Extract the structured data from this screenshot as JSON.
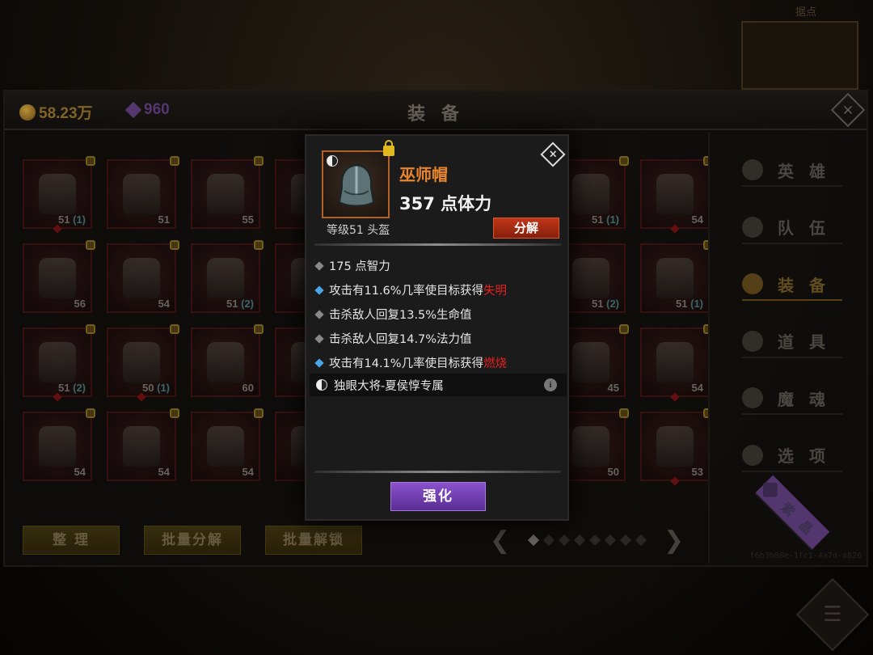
{
  "background": {
    "top_label": "据点",
    "menu_icon": "list-icon"
  },
  "header": {
    "gold": "58.23万",
    "gems": "960",
    "title": "装 备",
    "gold_icon": "coin-icon",
    "gem_icon": "gem-icon"
  },
  "grid": {
    "slots": [
      {
        "lvl": "51",
        "bonus": "(1)",
        "lock": true,
        "pip": true
      },
      {
        "lvl": "51",
        "bonus": "",
        "lock": true,
        "pip": false
      },
      {
        "lvl": "55",
        "bonus": "",
        "lock": true,
        "pip": false
      },
      {
        "lvl": "",
        "bonus": "",
        "lock": true,
        "pip": false
      },
      {
        "lvl": "51",
        "bonus": "(1)",
        "lock": true,
        "pip": false
      },
      {
        "lvl": "54",
        "bonus": "",
        "lock": true,
        "pip": true
      },
      {
        "lvl": "56",
        "bonus": "",
        "lock": true,
        "pip": false
      },
      {
        "lvl": "54",
        "bonus": "",
        "lock": true,
        "pip": false
      },
      {
        "lvl": "51",
        "bonus": "(2)",
        "lock": true,
        "pip": false
      },
      {
        "lvl": "",
        "bonus": "",
        "lock": true,
        "pip": false
      },
      {
        "lvl": "51",
        "bonus": "(2)",
        "lock": false,
        "pip": false
      },
      {
        "lvl": "51",
        "bonus": "(1)",
        "lock": true,
        "pip": false
      },
      {
        "lvl": "51",
        "bonus": "(2)",
        "lock": true,
        "pip": true
      },
      {
        "lvl": "50",
        "bonus": "(1)",
        "lock": true,
        "pip": true
      },
      {
        "lvl": "60",
        "bonus": "",
        "lock": true,
        "pip": false
      },
      {
        "lvl": "",
        "bonus": "",
        "lock": true,
        "pip": false
      },
      {
        "lvl": "45",
        "bonus": "",
        "lock": true,
        "pip": false
      },
      {
        "lvl": "54",
        "bonus": "",
        "lock": true,
        "pip": true
      },
      {
        "lvl": "54",
        "bonus": "",
        "lock": true,
        "pip": false
      },
      {
        "lvl": "54",
        "bonus": "",
        "lock": true,
        "pip": false
      },
      {
        "lvl": "54",
        "bonus": "",
        "lock": true,
        "pip": false
      },
      {
        "lvl": "",
        "bonus": "",
        "lock": true,
        "pip": false
      },
      {
        "lvl": "50",
        "bonus": "",
        "lock": true,
        "pip": false
      },
      {
        "lvl": "53",
        "bonus": "",
        "lock": true,
        "pip": true
      }
    ]
  },
  "sidenav": {
    "items": [
      {
        "label": "英 雄",
        "icon": "hero-icon"
      },
      {
        "label": "队 伍",
        "icon": "flag-icon"
      },
      {
        "label": "装 备",
        "icon": "helmet-icon"
      },
      {
        "label": "道 具",
        "icon": "bag-icon"
      },
      {
        "label": "魔 魂",
        "icon": "flame-icon"
      },
      {
        "label": "选 项",
        "icon": "gear-icon"
      },
      {
        "label": "紫 晶",
        "icon": "amethyst-icon"
      }
    ],
    "active_index": 2,
    "uuid": "f6b3b08e-1fc1-4a7d-a826"
  },
  "bottom": {
    "sort_label": "整 理",
    "batch_split_label": "批量分解",
    "batch_unlock_label": "批量解锁",
    "pager_left": "❮",
    "pager_right": "❯",
    "page_count": 8,
    "current_page": 1
  },
  "popup": {
    "item_name": "巫师帽",
    "main_stat": "357 点体力",
    "item_type": "等级51 头盔",
    "split_label": "分解",
    "close_label": "×",
    "stats": [
      {
        "bullet": "gray",
        "text": "175 点智力",
        "highlight": ""
      },
      {
        "bullet": "blue",
        "text": "攻击有11.6%几率使目标获得",
        "highlight": "失明"
      },
      {
        "bullet": "gray",
        "text": "击杀敌人回复13.5%生命值",
        "highlight": ""
      },
      {
        "bullet": "gray",
        "text": "击杀敌人回复14.7%法力值",
        "highlight": ""
      },
      {
        "bullet": "blue",
        "text": "攻击有14.1%几率使目标获得",
        "highlight": "燃烧"
      }
    ],
    "exclusive": "独眼大将-夏侯惇专属",
    "info_label": "i",
    "enhance_label": "强化",
    "colors": {
      "name": "#e8852e",
      "highlight": "#e52020",
      "blue_bullet": "#4aa5e6",
      "enhance": "#7a45bd"
    }
  }
}
